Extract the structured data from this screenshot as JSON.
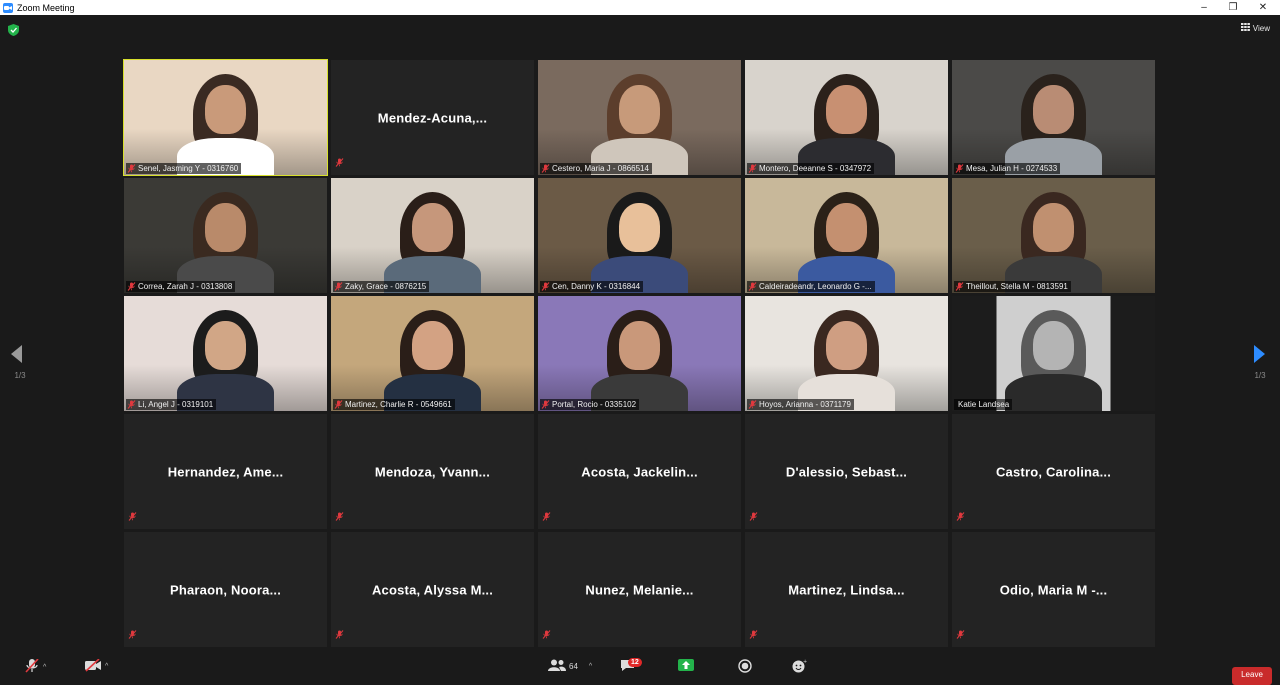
{
  "window": {
    "title": "Zoom Meeting"
  },
  "top": {
    "view_label": "View"
  },
  "pagination": {
    "left_label": "1/3",
    "right_label": "1/3"
  },
  "tiles": [
    {
      "type": "video",
      "caption": "Senel, Jasming Y - 0316760",
      "active": true
    },
    {
      "type": "name",
      "name": "Mendez-Acuna,..."
    },
    {
      "type": "video",
      "caption": "Cestero, Maria J - 0866514"
    },
    {
      "type": "video",
      "caption": "Montero, Deeanne S - 0347972"
    },
    {
      "type": "video",
      "caption": "Mesa, Julian H - 0274533"
    },
    {
      "type": "video",
      "caption": "Correa, Zarah J - 0313808"
    },
    {
      "type": "video",
      "caption": "Zaky, Grace - 0876215"
    },
    {
      "type": "video",
      "caption": "Cen, Danny K - 0316844"
    },
    {
      "type": "video",
      "caption": "Caldeiradeandr, Leonardo G -..."
    },
    {
      "type": "video",
      "caption": "Theillout, Stella M - 0813591"
    },
    {
      "type": "video",
      "caption": "Li, Angel J - 0319101"
    },
    {
      "type": "video",
      "caption": "Martinez, Charlie R - 0549661"
    },
    {
      "type": "video",
      "caption": "Portal, Rocio - 0335102"
    },
    {
      "type": "video",
      "caption": "Hoyos, Arianna - 0371179"
    },
    {
      "type": "video",
      "caption": "Katie Landsea",
      "unmuted": true
    },
    {
      "type": "name",
      "name": "Hernandez, Ame..."
    },
    {
      "type": "name",
      "name": "Mendoza, Yvann..."
    },
    {
      "type": "name",
      "name": "Acosta, Jackelin..."
    },
    {
      "type": "name",
      "name": "D'alessio, Sebast..."
    },
    {
      "type": "name",
      "name": "Castro, Carolina..."
    },
    {
      "type": "name",
      "name": "Pharaon, Noora..."
    },
    {
      "type": "name",
      "name": "Acosta, Alyssa M..."
    },
    {
      "type": "name",
      "name": "Nunez, Melanie..."
    },
    {
      "type": "name",
      "name": "Martinez, Lindsa..."
    },
    {
      "type": "name",
      "name": "Odio, Maria M -..."
    }
  ],
  "toolbar": {
    "participants_count": "64",
    "chat_badge": "12",
    "leave_label": "Leave"
  },
  "colors": {
    "active_speaker": "#d8e02c",
    "mute_red": "#e0393e",
    "share_green": "#23b34b",
    "leave_red": "#c92b2b",
    "arrow_blue": "#2d8cff"
  }
}
